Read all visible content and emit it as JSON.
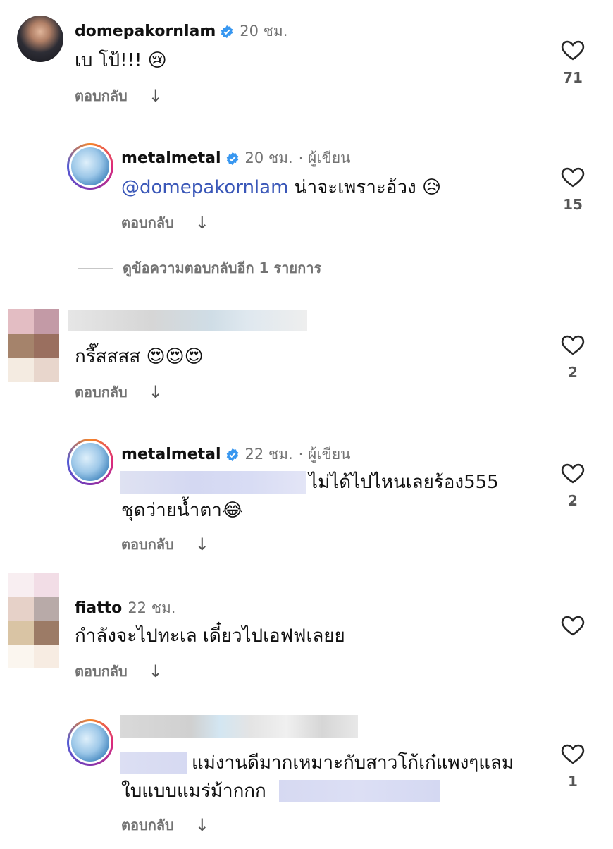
{
  "comments": [
    {
      "username": "domepakornlam",
      "verified": true,
      "time": "20 ชม.",
      "text": "เบ โป้!!! 😢",
      "reply_label": "ตอบกลับ",
      "likes": "71"
    },
    {
      "username": "metalmetal",
      "verified": true,
      "time": "20 ชม.",
      "author_tag": "· ผู้เขียน",
      "mention": "@domepakornlam",
      "text": "น่าจะเพราะอ้วง 😥",
      "reply_label": "ตอบกลับ",
      "likes": "15"
    },
    {
      "username": "",
      "text": "กรี๊สสสส 😍😍😍",
      "reply_label": "ตอบกลับ",
      "likes": "2"
    },
    {
      "username": "metalmetal",
      "verified": true,
      "time": "22 ชม.",
      "author_tag": "· ผู้เขียน",
      "text_line1": "ไม่ได้ไปไหนเลยร้อง555",
      "text_line2": "ชุดว่ายน้ำตา😂",
      "reply_label": "ตอบกลับ",
      "likes": "2"
    },
    {
      "username": "fiatto",
      "time": "22 ชม.",
      "text": "กำลังจะไปทะเล เดี๋ยวไปเอฟฟเลยย",
      "reply_label": "ตอบกลับ",
      "likes": ""
    },
    {
      "username": "",
      "text_line1": "แม่งานดีมากเหมาะกับสาวโก้เก๋แพงๆแลม",
      "text_line2": "ใบแบบแมร่ม้ากกก",
      "reply_label": "ตอบกลับ",
      "likes": "1"
    }
  ],
  "view_more_replies": "ดูข้อความตอบกลับอีก 1 รายการ",
  "icons": {
    "verified": "verified-badge-icon",
    "heart": "heart-outline-icon",
    "arrow": "arrow-down-icon"
  },
  "colors": {
    "verified": "#3897f0",
    "mention": "#3a57b8",
    "meta": "#737373"
  }
}
